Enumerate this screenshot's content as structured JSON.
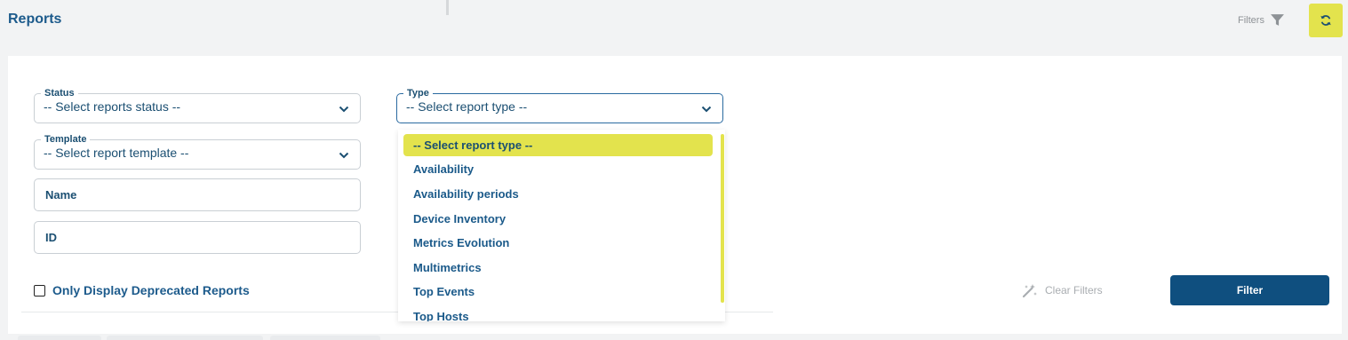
{
  "header": {
    "title": "Reports",
    "filters_label": "Filters"
  },
  "filters": {
    "status": {
      "label": "Status",
      "value": "-- Select reports status --"
    },
    "type": {
      "label": "Type",
      "value": "-- Select report type --"
    },
    "template": {
      "label": "Template",
      "value": "-- Select report template --"
    },
    "name": {
      "placeholder": "Name"
    },
    "id": {
      "placeholder": "ID"
    },
    "deprecated_label": "Only Display Deprecated Reports",
    "clear_label": "Clear Filters",
    "filter_button": "Filter"
  },
  "type_dropdown": {
    "options": [
      "-- Select report type --",
      "Availability",
      "Availability periods",
      "Device Inventory",
      "Metrics Evolution",
      "Multimetrics",
      "Top Events",
      "Top Hosts"
    ],
    "selected_index": 0
  },
  "colors": {
    "accent": "#e3e34d",
    "primary": "#0f4f7f",
    "text": "#1b4f72"
  },
  "icons": {
    "filters": "funnel-icon",
    "refresh": "refresh-icon",
    "clear": "magic-wand-icon",
    "select": "chevron-down-icon"
  }
}
